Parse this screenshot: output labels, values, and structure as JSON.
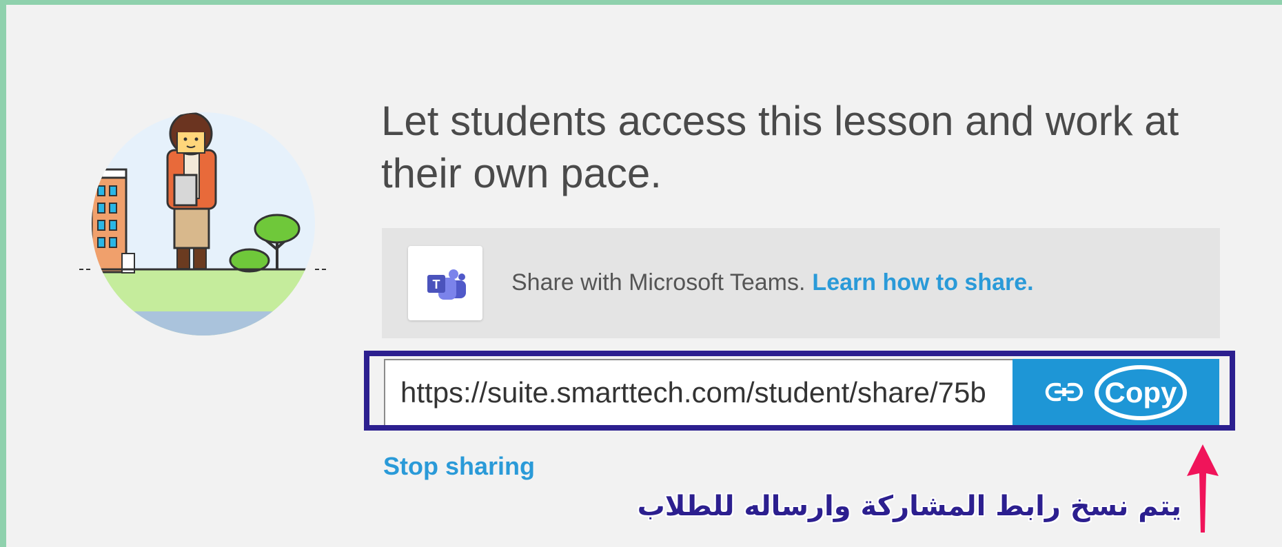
{
  "share": {
    "heading": "Let students access this lesson and work at their own pace.",
    "illustration_icon": "student-with-tablet-illustration",
    "teams": {
      "icon": "microsoft-teams-logo",
      "text": "Share with Microsoft Teams.",
      "link": "Learn how to share."
    },
    "url_value": "https://suite.smarttech.com/student/share/75b",
    "copy_icon": "link-icon",
    "copy_label": "Copy",
    "stop_sharing": "Stop sharing"
  },
  "annotation": {
    "text": "يتم نسخ رابط المشاركة وارساله للطلاب",
    "arrow_icon": "arrow-up-icon",
    "frame_color": "#2c1f8f",
    "arrow_color": "#f0145a",
    "text_color": "#2c1f8f"
  },
  "colors": {
    "accent": "#1e96d6",
    "link": "#2a9ad8",
    "frame_border": "#8fd1ad"
  }
}
